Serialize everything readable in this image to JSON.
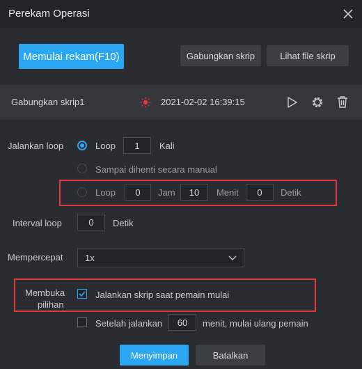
{
  "window": {
    "title": "Perekam Operasi"
  },
  "toolbar": {
    "record_label": "Memulai rekam(F10)",
    "merge_label": "Gabungkan skrip",
    "view_label": "Lihat file skrip"
  },
  "script": {
    "name": "Gabungkan skrip1",
    "datetime": "2021-02-02 16:39:15"
  },
  "run_loop": {
    "label": "Jalankan loop",
    "option1": {
      "text": "Loop",
      "count": "1",
      "unit": "Kali",
      "selected": true
    },
    "option2": {
      "text": "Sampai dihenti secara manual",
      "selected": false
    },
    "option3": {
      "text": "Loop",
      "hours": "0",
      "hours_unit": "Jam",
      "minutes": "10",
      "minutes_unit": "Menit",
      "seconds": "0",
      "seconds_unit": "Detik",
      "selected": false
    }
  },
  "interval": {
    "label": "Interval loop",
    "value": "0",
    "unit": "Detik"
  },
  "speed": {
    "label": "Mempercepat",
    "value": "1x"
  },
  "open_options": {
    "label_line1": "Membuka",
    "label_line2": "pilihan",
    "run_on_start": {
      "text": "Jalankan skrip saat pemain mulai",
      "checked": true
    },
    "restart_after": {
      "text_before": "Setelah jalankan",
      "value": "60",
      "text_after": "menit, mulai ulang pemain",
      "checked": false
    }
  },
  "footer": {
    "save_label": "Menyimpan",
    "cancel_label": "Batalkan"
  },
  "colors": {
    "accent": "#2aa6f2",
    "highlight_box": "#e03a3e",
    "record_indicator": "#e03a3e",
    "background": "#2b2c31"
  }
}
